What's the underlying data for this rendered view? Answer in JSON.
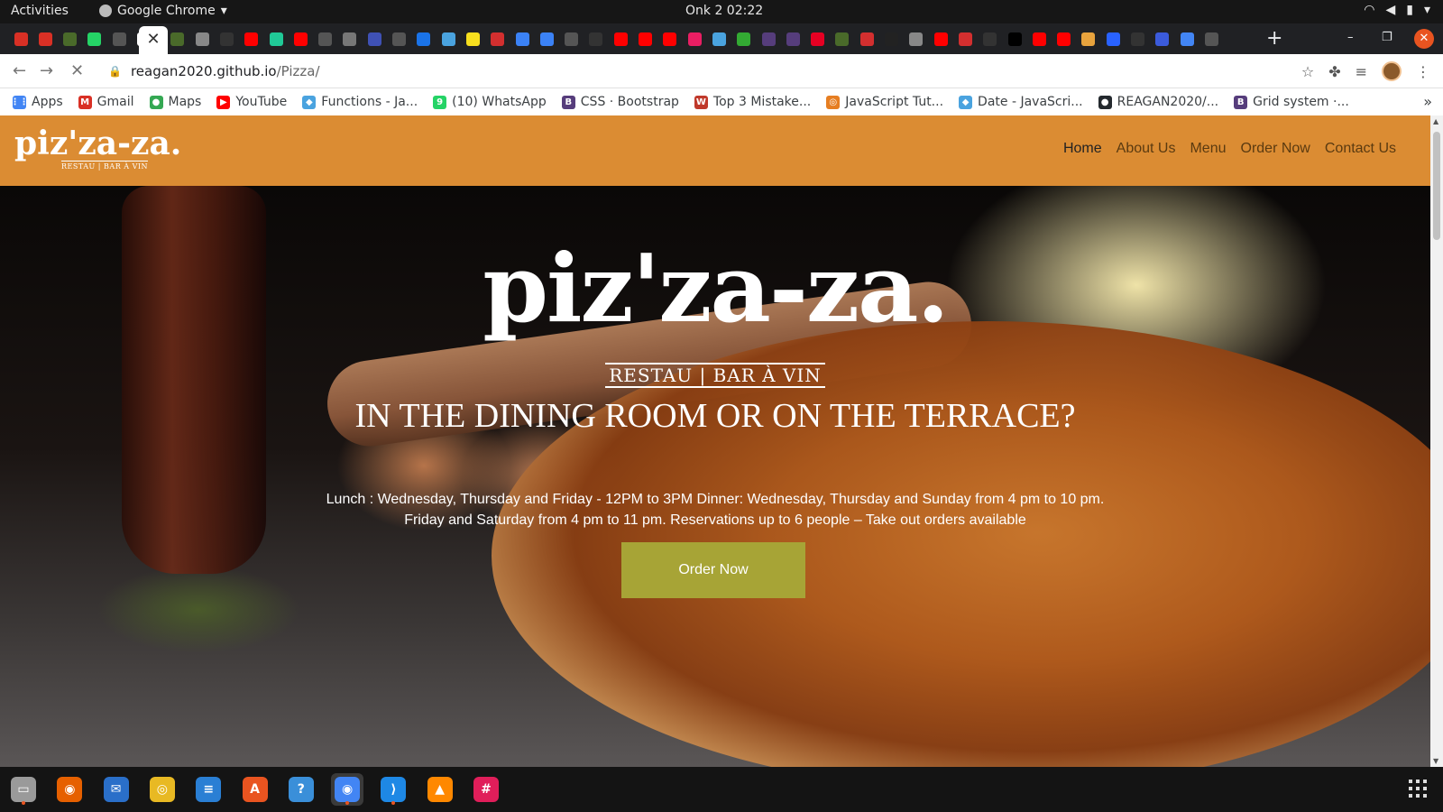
{
  "system": {
    "activities_label": "Activities",
    "app_name": "Google Chrome",
    "clock": "Onk 2  02:22"
  },
  "browser": {
    "url_domain": "reagan2020.github.io",
    "url_path": "/Pizza/",
    "tab_colors": [
      "#d93025",
      "#d93025",
      "#4a6a2a",
      "#25d366",
      "#555",
      "#ffffff",
      "#4a6a2a",
      "#888",
      "#333",
      "#ff0000",
      "#20c997",
      "#ff0000",
      "#555",
      "#777",
      "#3f51b5",
      "#555",
      "#1a73e8",
      "#4aa3df",
      "#f7df1e",
      "#d32f2f",
      "#3b82f6",
      "#3b82f6",
      "#555",
      "#333",
      "#ff0000",
      "#ff0000",
      "#ff0000",
      "#e91e63",
      "#4aa3df",
      "#3a3",
      "#563d7c",
      "#563d7c",
      "#e60023",
      "#4a6a2a",
      "#d32f2f",
      "#222",
      "#888",
      "#ff0000",
      "#d32f2f",
      "#333",
      "#000",
      "#ff0000",
      "#ff0000",
      "#e8a33d",
      "#2962ff",
      "#333",
      "#3b5bdb",
      "#4285f4",
      "#555"
    ]
  },
  "bookmarks": [
    {
      "label": "Apps",
      "icon": "apps-grid-icon",
      "color": "#4285f4",
      "glyph": "⋮⋮"
    },
    {
      "label": "Gmail",
      "icon": "gmail-icon",
      "color": "#d93025",
      "glyph": "M"
    },
    {
      "label": "Maps",
      "icon": "maps-pin-icon",
      "color": "#34a853",
      "glyph": "●"
    },
    {
      "label": "YouTube",
      "icon": "youtube-icon",
      "color": "#ff0000",
      "glyph": "▶"
    },
    {
      "label": "Functions - Ja...",
      "icon": "w3schools-icon",
      "color": "#4aa3df",
      "glyph": "◆"
    },
    {
      "label": "(10) WhatsApp",
      "icon": "whatsapp-icon",
      "color": "#25d366",
      "glyph": "9"
    },
    {
      "label": "CSS · Bootstrap",
      "icon": "bootstrap-icon",
      "color": "#563d7c",
      "glyph": "B"
    },
    {
      "label": "Top 3 Mistake...",
      "icon": "web-dev-icon",
      "color": "#c0392b",
      "glyph": "W"
    },
    {
      "label": "JavaScript Tut...",
      "icon": "javascript-tut-icon",
      "color": "#e67e22",
      "glyph": "◎"
    },
    {
      "label": "Date - JavaScri...",
      "icon": "w3schools-icon",
      "color": "#4aa3df",
      "glyph": "◆"
    },
    {
      "label": "REAGAN2020/...",
      "icon": "github-icon",
      "color": "#24292e",
      "glyph": "●"
    },
    {
      "label": "Grid system ·...",
      "icon": "bootstrap-icon",
      "color": "#563d7c",
      "glyph": "B"
    }
  ],
  "site": {
    "logo_text": "piz'za-za.",
    "logo_sub": "RESTAU | BAR À VIN",
    "nav": {
      "home": "Home",
      "about": "About Us",
      "menu": "Menu",
      "order": "Order Now",
      "contact": "Contact Us"
    },
    "hero": {
      "logo": "piz'za-za.",
      "sub": "RESTAU  |  BAR À VIN",
      "headline": "IN THE DINING ROOM OR ON THE TERRACE?",
      "hours_line1": "Lunch : Wednesday, Thursday and Friday - 12PM to 3PM Dinner: Wednesday, Thursday and Sunday from 4 pm to 10 pm.",
      "hours_line2": "Friday and Saturday from 4 pm to 11 pm. Reservations up to 6 people – Take out orders available",
      "button": "Order Now"
    },
    "colors": {
      "navbar": "#db8c33",
      "button": "#a7a436"
    }
  },
  "dock": [
    {
      "name": "files-icon",
      "color": "#9a9a9a",
      "glyph": "▭",
      "running": true
    },
    {
      "name": "firefox-icon",
      "color": "#e66000",
      "glyph": "◉",
      "running": false
    },
    {
      "name": "thunderbird-icon",
      "color": "#2a6fc9",
      "glyph": "✉",
      "running": false
    },
    {
      "name": "rhythmbox-icon",
      "color": "#e8b923",
      "glyph": "◎",
      "running": false
    },
    {
      "name": "writer-icon",
      "color": "#2a7fd4",
      "glyph": "≡",
      "running": false
    },
    {
      "name": "software-center-icon",
      "color": "#e95420",
      "glyph": "A",
      "running": false
    },
    {
      "name": "help-icon",
      "color": "#3a8fd9",
      "glyph": "?",
      "running": false
    },
    {
      "name": "chrome-icon",
      "color": "#4285f4",
      "glyph": "◉",
      "running": true
    },
    {
      "name": "vscode-icon",
      "color": "#1e88e5",
      "glyph": "⟩",
      "running": true
    },
    {
      "name": "vlc-icon",
      "color": "#ff8800",
      "glyph": "▲",
      "running": false
    },
    {
      "name": "slack-icon",
      "color": "#e01e5a",
      "glyph": "#",
      "running": false
    }
  ]
}
